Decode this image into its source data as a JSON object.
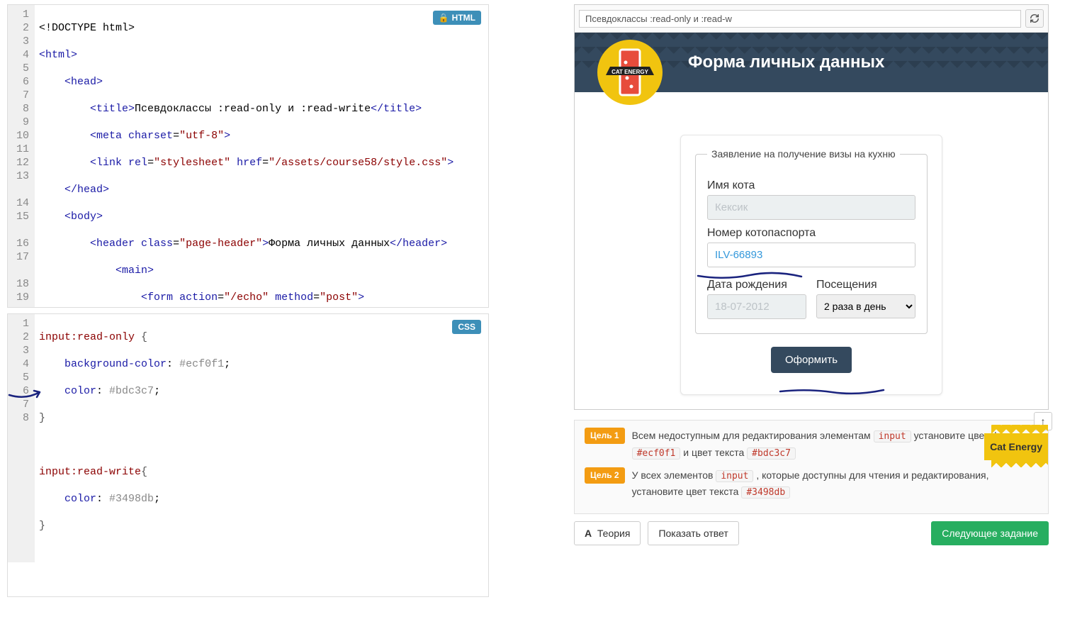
{
  "editors": {
    "html_badge": "HTML",
    "css_badge": "CSS",
    "html_gutter": [
      "1",
      "2",
      "3",
      "4",
      "5",
      "6",
      "7",
      "8",
      "9",
      "10",
      "11",
      "12",
      "13",
      "",
      "14",
      "15",
      "",
      "16",
      "17",
      "",
      "18",
      "19"
    ],
    "css_gutter": [
      "1",
      "2",
      "3",
      "4",
      "5",
      "6",
      "7",
      "8"
    ]
  },
  "preview": {
    "address": "Псевдоклассы :read-only и :read-w",
    "header": "Форма личных данных",
    "logo_text": "CAT ENERGY",
    "legend": "Заявление на получение визы на кухню",
    "label_name": "Имя кота",
    "value_name": "Кексик",
    "label_passport": "Номер котопаспорта",
    "value_passport": "ILV-66893",
    "label_dob": "Дата рождения",
    "value_dob": "18-07-2012",
    "label_visits": "Посещения",
    "value_visits": "2 раза в день",
    "submit": "Оформить"
  },
  "goals": {
    "g1_badge": "Цель 1",
    "g1_text_a": "Всем недоступным для редактирования элементам ",
    "g1_code_a": "input",
    "g1_text_b": " установите цвет фона ",
    "g1_code_b": "#ecf0f1",
    "g1_text_c": " и цвет текста ",
    "g1_code_c": "#bdc3c7",
    "g2_badge": "Цель 2",
    "g2_text_a": "У всех элементов ",
    "g2_code_a": "input",
    "g2_text_b": " , которые доступны для чтения и редактирования, установите цвет текста ",
    "g2_code_b": "#3498db",
    "yellow_tab": "Cat Energy"
  },
  "buttons": {
    "theory": "Теория",
    "show_answer": "Показать ответ",
    "next": "Следующее задание"
  }
}
